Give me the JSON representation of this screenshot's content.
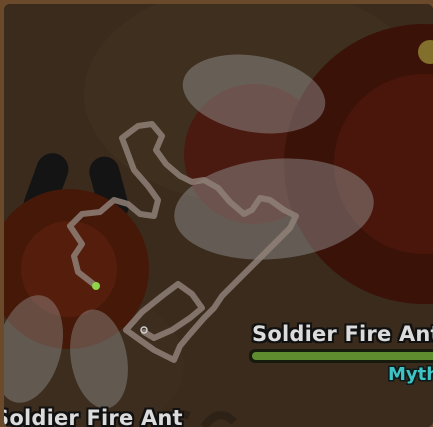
{
  "mobs": [
    {
      "name": "Soldier Fire Ant",
      "rarity": "Myth",
      "hp_fraction": 1.0
    },
    {
      "name": "Soldier Fire Ant"
    }
  ],
  "colors": {
    "ground": "#3a2b1c",
    "fire_ant_body": "#4a1a10",
    "fire_ant_core": "#5a1f12",
    "wing": "#8a8a8a",
    "trail": "#9a8a7e",
    "health_green": "#5f8c2e",
    "player_dot": "#8fd44a",
    "rarity_myth": "#3fc4c6"
  }
}
